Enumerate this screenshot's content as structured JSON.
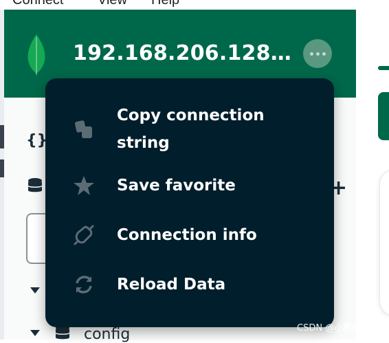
{
  "menubar": {
    "items": [
      "Connect",
      "View",
      "Help"
    ]
  },
  "header": {
    "connection_title": "192.168.206.128:2...",
    "more_button_icon": "ellipsis-icon",
    "logo_icon": "mongodb-leaf-icon"
  },
  "sidebar": {
    "tree_item_label": "config",
    "icons": [
      "braces-icon",
      "database-icon",
      "database-icon"
    ]
  },
  "context_menu": {
    "items": [
      {
        "label": "Copy connection string",
        "icon": "copy-icon"
      },
      {
        "label": "Save favorite",
        "icon": "star-icon"
      },
      {
        "label": "Connection info",
        "icon": "connection-icon"
      },
      {
        "label": "Reload Data",
        "icon": "refresh-icon"
      }
    ]
  },
  "watermark": "CSDN @小胖鲸~",
  "colors": {
    "header_green": "#00684a",
    "menu_bg": "#001e2b",
    "menu_text": "#ffffff",
    "menu_icon": "#5c6c75"
  }
}
